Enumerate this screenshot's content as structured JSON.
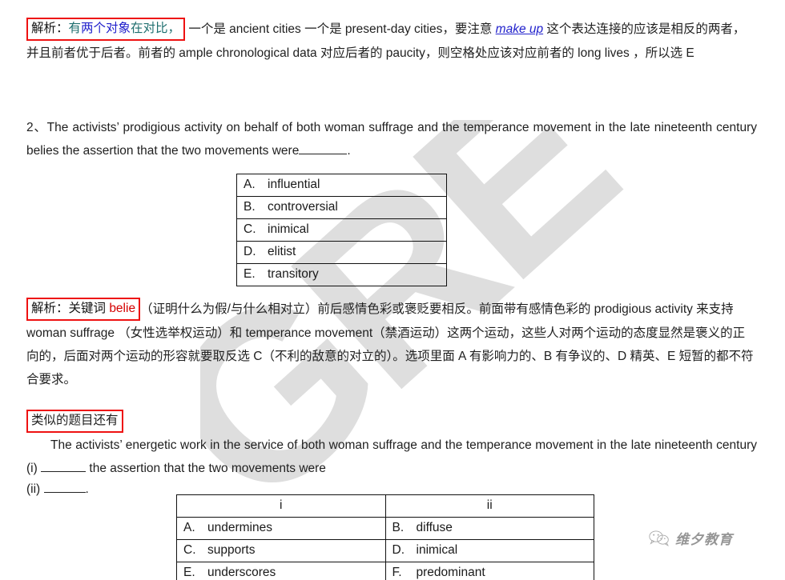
{
  "document": {
    "watermark_text": "GRE",
    "background_color": "#ffffff"
  },
  "explanation_1": {
    "box_label_prefix": "解析：",
    "box_seg_teal_1": "有",
    "box_seg_blue": "两个对象",
    "box_seg_teal_2": "在对比，",
    "body_part_1": " 一个是 ancient cities 一个是 present-day cities，要注意 ",
    "link_text": "make up",
    "body_part_2": " 这个表达连接的应该是相反的两者，并且前者优于后者。前者的 ample chronological data 对应后者的 paucity，则空格处应该对应前者的 long lives ，所以选 E"
  },
  "question_2": {
    "number": "2、",
    "text": "The activists’ prodigious activity on behalf of both woman suffrage and the temperance movement in the late nineteenth century belies the assertion that the two movements were",
    "trailing": "."
  },
  "options_single": {
    "rows": [
      {
        "letter": "A.",
        "text": "influential"
      },
      {
        "letter": "B.",
        "text": "controversial"
      },
      {
        "letter": "C.",
        "text": "inimical"
      },
      {
        "letter": "D.",
        "text": "elitist"
      },
      {
        "letter": "E.",
        "text": "transitory"
      }
    ]
  },
  "explanation_2": {
    "box_label_prefix": "解析：关键词 ",
    "box_keyword": "belie",
    "body": "（证明什么为假/与什么相对立）前后感情色彩或褒贬要相反。前面带有感情色彩的 prodigious activity 来支持 woman suffrage （女性选举权运动）和 temperance movement（禁酒运动）这两个运动，这些人对两个运动的态度显然是褒义的正向的，后面对两个运动的形容就要取反选 C（不利的敌意的对立的）。选项里面 A 有影响力的、B 有争议的、D 精英、E 短暂的都不符合要求。"
  },
  "similar": {
    "box_label": "类似的题目还有",
    "text_part_1": "The activists’ energetic work in the service of both woman suffrage and the temperance movement in the late nineteenth century (i)",
    "text_part_2": "the assertion that the two movements   were",
    "text_part_3": "(ii)",
    "text_part_4": "."
  },
  "options_dual": {
    "header_col_1": "i",
    "header_col_2": "ii",
    "rows": [
      {
        "left_letter": "A.",
        "left_text": "undermines",
        "right_letter": "B.",
        "right_text": "diffuse"
      },
      {
        "left_letter": "C.",
        "left_text": "supports",
        "right_letter": "D.",
        "right_text": "inimical"
      },
      {
        "left_letter": "E.",
        "left_text": "underscores",
        "right_letter": "F.",
        "right_text": "predominant"
      }
    ]
  },
  "footer": {
    "icon": "wechat-icon",
    "brand_name": "维夕教育"
  },
  "colors": {
    "highlight_box": "#ee1111",
    "keyword_red": "#d40000",
    "link_blue": "#2222cc",
    "teal": "#1f6f6f",
    "watermark": "#dedede"
  }
}
